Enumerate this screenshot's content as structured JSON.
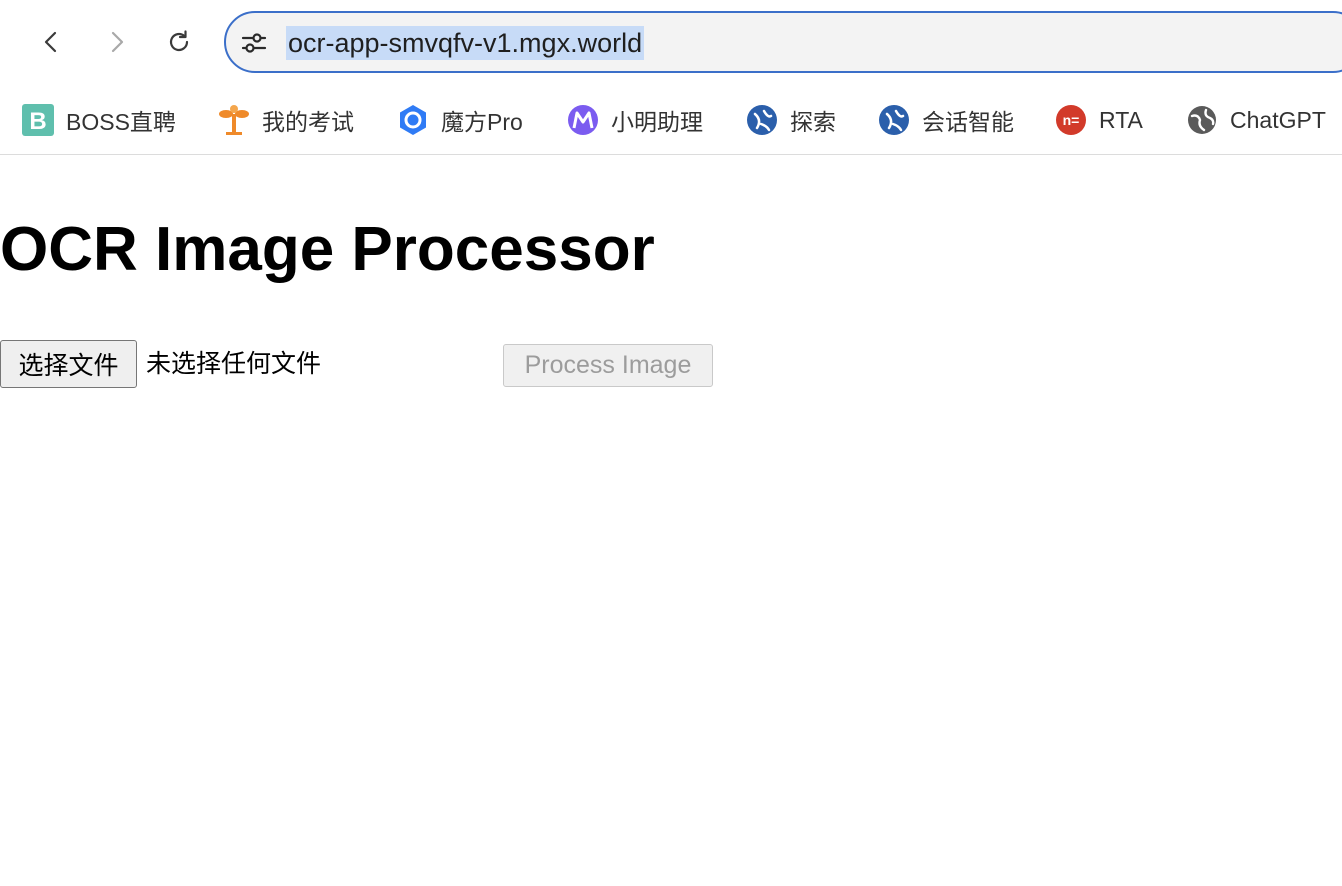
{
  "browser": {
    "url": "ocr-app-smvqfv-v1.mgx.world",
    "bookmarks": [
      {
        "label": "BOSS直聘",
        "icon": "boss-zhipin-icon",
        "color": "#5fbfad"
      },
      {
        "label": "我的考试",
        "icon": "plant-icon",
        "color": "#ef8a2a"
      },
      {
        "label": "魔方Pro",
        "icon": "mofang-icon",
        "color": "#2f7bf5"
      },
      {
        "label": "小明助理",
        "icon": "xiaoming-icon",
        "color": "#7b5cf0"
      },
      {
        "label": "探索",
        "icon": "explore-icon",
        "color": "#2b5fab"
      },
      {
        "label": "会话智能",
        "icon": "conversation-icon",
        "color": "#2b5fab"
      },
      {
        "label": "RTA",
        "icon": "rta-icon",
        "color": "#d23a2a"
      },
      {
        "label": "ChatGPT",
        "icon": "globe-icon",
        "color": "#555555"
      }
    ]
  },
  "page": {
    "title": "OCR Image Processor",
    "choose_file_label": "选择文件",
    "no_file_text": "未选择任何文件",
    "process_button_label": "Process Image",
    "process_button_disabled": true
  }
}
